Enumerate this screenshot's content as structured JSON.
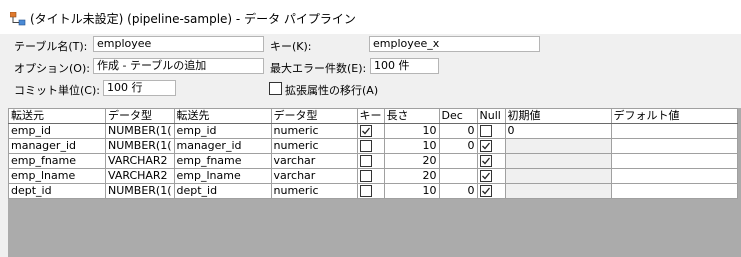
{
  "window": {
    "title": "(タイトル未設定) (pipeline-sample) - データ パイプライン"
  },
  "form": {
    "table_label": "テーブル名(T):",
    "table_value": "employee",
    "key_label": "キー(K):",
    "key_value": "employee_x",
    "option_label": "オプション(O):",
    "option_value": "作成 - テーブルの追加",
    "max_err_label": "最大エラー件数(E):",
    "max_err_value": "100 件",
    "commit_label": "コミット単位(C):",
    "commit_value": "100 行",
    "ext_attr_label": "拡張属性の移行(A)"
  },
  "grid": {
    "headers": [
      "転送元",
      "データ型",
      "転送先",
      "データ型",
      "キー",
      "長さ",
      "Dec",
      "Null",
      "初期値",
      "デフォルト値"
    ],
    "rows": [
      {
        "src": "emp_id",
        "src_type": "NUMBER(1(",
        "dst": "emp_id",
        "dst_type": "numeric",
        "key": true,
        "len": "10",
        "dec": "0",
        "null": false,
        "init": "0",
        "default": ""
      },
      {
        "src": "manager_id",
        "src_type": "NUMBER(1(",
        "dst": "manager_id",
        "dst_type": "numeric",
        "key": false,
        "len": "10",
        "dec": "0",
        "null": true,
        "init": "",
        "default": ""
      },
      {
        "src": "emp_fname",
        "src_type": "VARCHAR2",
        "dst": "emp_fname",
        "dst_type": "varchar",
        "key": false,
        "len": "20",
        "dec": "",
        "null": true,
        "init": "",
        "default": ""
      },
      {
        "src": "emp_lname",
        "src_type": "VARCHAR2",
        "dst": "emp_lname",
        "dst_type": "varchar",
        "key": false,
        "len": "20",
        "dec": "",
        "null": true,
        "init": "",
        "default": ""
      },
      {
        "src": "dept_id",
        "src_type": "NUMBER(1(",
        "dst": "dept_id",
        "dst_type": "numeric",
        "key": false,
        "len": "10",
        "dec": "0",
        "null": true,
        "init": "",
        "default": ""
      }
    ]
  }
}
